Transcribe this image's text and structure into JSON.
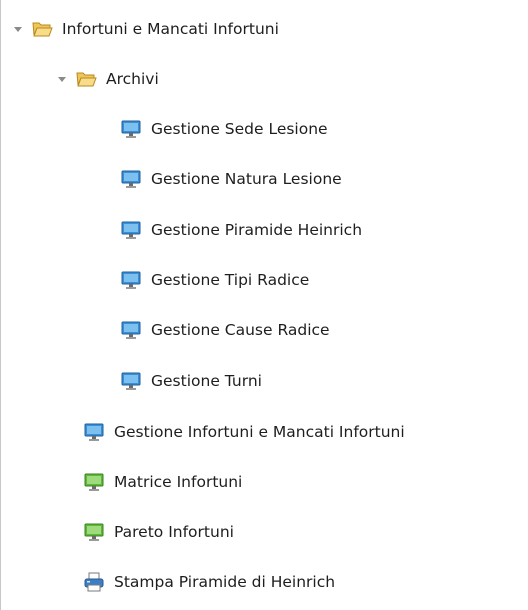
{
  "tree": {
    "root": {
      "label": "Infortuni e Mancati Infortuni",
      "icon": "open-folder-icon",
      "expanded": true,
      "children": {
        "archivi": {
          "label": "Archivi",
          "icon": "open-folder-icon",
          "expanded": true,
          "items": [
            {
              "label": "Gestione Sede Lesione",
              "icon": "monitor-icon"
            },
            {
              "label": "Gestione Natura Lesione",
              "icon": "monitor-icon"
            },
            {
              "label": "Gestione Piramide Heinrich",
              "icon": "monitor-icon"
            },
            {
              "label": "Gestione Tipi Radice",
              "icon": "monitor-icon"
            },
            {
              "label": "Gestione Cause Radice",
              "icon": "monitor-icon"
            },
            {
              "label": "Gestione Turni",
              "icon": "monitor-icon"
            }
          ]
        },
        "items": [
          {
            "label": "Gestione Infortuni e Mancati Infortuni",
            "icon": "monitor-icon"
          },
          {
            "label": "Matrice Infortuni",
            "icon": "green-monitor-icon"
          },
          {
            "label": "Pareto Infortuni",
            "icon": "green-monitor-icon"
          },
          {
            "label": "Stampa Piramide di Heinrich",
            "icon": "printer-icon"
          }
        ]
      }
    }
  },
  "colors": {
    "folder": "#f2d27a",
    "monitor_blue": "#3a8fd6",
    "monitor_green": "#5fb83a",
    "printer": "#3e7fc4"
  }
}
